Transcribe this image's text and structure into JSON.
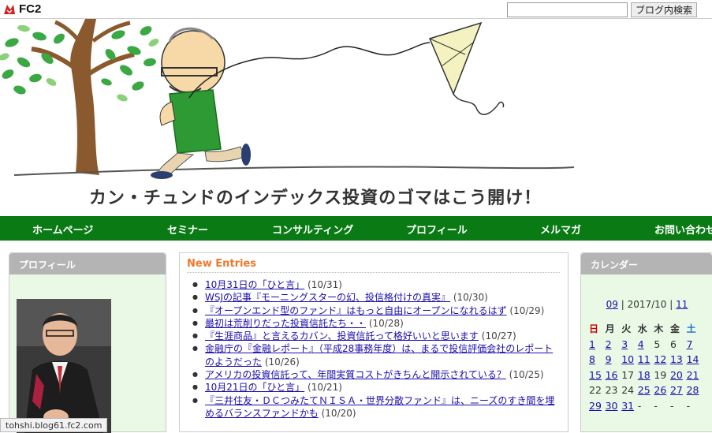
{
  "topbar": {
    "logo_text": "FC2",
    "search_placeholder": "",
    "search_button": "ブログ内検索"
  },
  "site": {
    "title": "カン・チュンドのインデックス投資のゴマはこう開け！"
  },
  "nav": {
    "items": [
      {
        "label": "ホームページ"
      },
      {
        "label": "セミナー"
      },
      {
        "label": "コンサルティング"
      },
      {
        "label": "プロフィール"
      },
      {
        "label": "メルマガ"
      },
      {
        "label": "お問い合わせ"
      }
    ]
  },
  "sidebar_left": {
    "title": "プロフィール"
  },
  "main": {
    "title": "New Entries",
    "entries": [
      {
        "title": "10月31日の「ひと言」",
        "date": "(10/31)"
      },
      {
        "title": "WSJの記事『モーニングスターの幻、投信格付けの真実』",
        "date": "(10/30)"
      },
      {
        "title": "『オープンエンド型のファンド』はもっと自由にオープンになれるはず",
        "date": "(10/29)"
      },
      {
        "title": "最初は荒削りだった投資信託たち・・",
        "date": "(10/28)"
      },
      {
        "title": "『生涯商品』と言えるカバン、投資信託って格好いいと思います",
        "date": "(10/27)"
      },
      {
        "title": "金融庁の『金融レポート』（平成28事務年度）は、まるで投信評価会社のレポートのようだった",
        "date": "(10/26)"
      },
      {
        "title": "アメリカの投資信託って、年間実質コストがきちんと開示されている？",
        "date": "(10/25)"
      },
      {
        "title": "10月21日の「ひと言」",
        "date": "(10/21)"
      },
      {
        "title": "『三井住友・ＤＣつみたてＮＩＳＡ・世界分散ファンド』は、ニーズのすき間を埋めるバランスファンドかも",
        "date": "(10/20)"
      }
    ]
  },
  "calendar": {
    "title": "カレンダー",
    "prev": "09",
    "current": "2017/10",
    "next": "11",
    "separator": "|",
    "weekdays": [
      "日",
      "月",
      "火",
      "水",
      "木",
      "金",
      "土"
    ],
    "weeks": [
      [
        {
          "d": "1",
          "link": true
        },
        {
          "d": "2",
          "link": true
        },
        {
          "d": "3",
          "link": true
        },
        {
          "d": "4",
          "link": true
        },
        {
          "d": "5",
          "link": false
        },
        {
          "d": "6",
          "link": false
        },
        {
          "d": "7",
          "link": true
        }
      ],
      [
        {
          "d": "8",
          "link": true
        },
        {
          "d": "9",
          "link": true
        },
        {
          "d": "10",
          "link": true
        },
        {
          "d": "11",
          "link": true
        },
        {
          "d": "12",
          "link": true
        },
        {
          "d": "13",
          "link": true
        },
        {
          "d": "14",
          "link": true
        }
      ],
      [
        {
          "d": "15",
          "link": true
        },
        {
          "d": "16",
          "link": true
        },
        {
          "d": "17",
          "link": false
        },
        {
          "d": "18",
          "link": true
        },
        {
          "d": "19",
          "link": false
        },
        {
          "d": "20",
          "link": true
        },
        {
          "d": "21",
          "link": true
        }
      ],
      [
        {
          "d": "22",
          "link": false
        },
        {
          "d": "23",
          "link": false
        },
        {
          "d": "24",
          "link": false
        },
        {
          "d": "25",
          "link": true
        },
        {
          "d": "26",
          "link": true
        },
        {
          "d": "27",
          "link": true
        },
        {
          "d": "28",
          "link": true
        }
      ],
      [
        {
          "d": "29",
          "link": true
        },
        {
          "d": "30",
          "link": true
        },
        {
          "d": "31",
          "link": true
        },
        {
          "d": "-",
          "link": false
        },
        {
          "d": "-",
          "link": false
        },
        {
          "d": "-",
          "link": false
        },
        {
          "d": "-",
          "link": false
        }
      ]
    ]
  },
  "status_bar": {
    "url": "tohshi.blog61.fc2.com"
  },
  "colors": {
    "nav_bg": "#0a7a14",
    "panel_bg": "#eaf9e6",
    "entries_header": "#f0782a",
    "link": "#1a0dab"
  }
}
